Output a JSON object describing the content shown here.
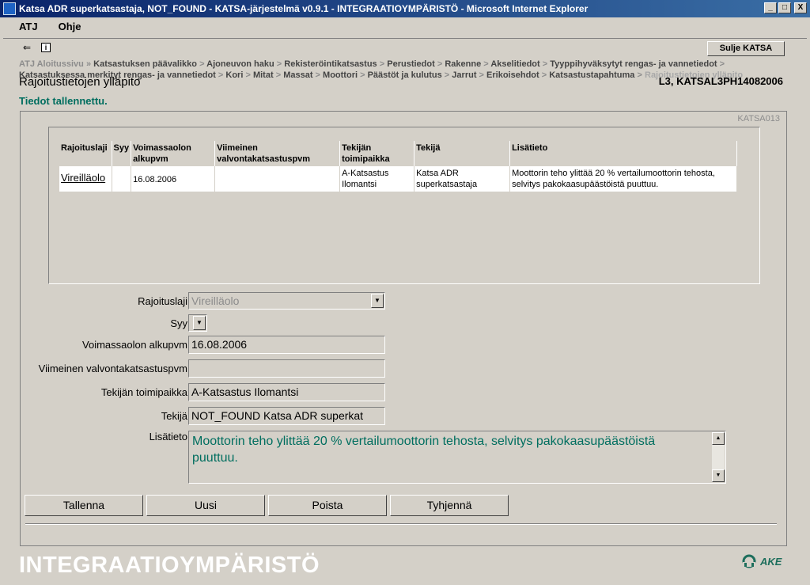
{
  "window": {
    "title": "Katsa ADR superkatsastaja, NOT_FOUND - KATSA-järjestelmä v0.9.1 - INTEGRAATIOYMPÄRISTÖ - Microsoft Internet Explorer",
    "minimize": "_",
    "maximize": "□",
    "close": "X"
  },
  "menu": {
    "items": [
      {
        "label": "ATJ"
      },
      {
        "label": "Ohje"
      }
    ]
  },
  "toolbar": {
    "back_icon": "back-arrow-icon",
    "info_icon": "info-icon",
    "close_label": "Sulje KATSA"
  },
  "breadcrumb": {
    "items": [
      "ATJ Aloitussivu",
      "Katsastuksen päävalikko",
      "Ajoneuvon haku",
      "Rekisteröintikatsastus",
      "Perustiedot",
      "Rakenne",
      "Akselitiedot",
      "Tyyppihyväksytyt rengas- ja vannetiedot",
      "Katsastuksessa merkityt rengas- ja vannetiedot",
      "Kori",
      "Mitat",
      "Massat",
      "Moottori",
      "Päästöt ja kulutus",
      "Jarrut",
      "Erikoisehdot",
      "Katsastustapahtuma",
      "Rajoitustietojen ylläpito"
    ],
    "sep_double": "»",
    "sep": ">"
  },
  "page": {
    "title": "Rajoitustietojen ylläpito",
    "id": "L3, KATSAL3PH14082006",
    "status": "Tiedot tallennettu.",
    "form_code": "KATSA013"
  },
  "table": {
    "headers": [
      "Rajoituslaji",
      "Syy",
      "Voimassaolon alkupvm",
      "Viimeinen valvontakatsastuspvm",
      "Tekijän toimipaikka",
      "Tekijä",
      "Lisätieto"
    ],
    "rows": [
      {
        "rajoituslaji": "Vireilläolo",
        "syy": "",
        "alkupvm": "16.08.2006",
        "valvontapvm": "",
        "toimipaikka": "A-Katsastus Ilomantsi",
        "tekija": "Katsa ADR superkatsastaja",
        "lisatieto": "Moottorin teho ylittää 20 % vertailumoottorin tehosta, selvitys pakokaasupäästöistä puuttuu."
      }
    ]
  },
  "form": {
    "rajoituslaji": {
      "label": "Rajoituslaji",
      "value": "Vireilläolo"
    },
    "syy": {
      "label": "Syy",
      "value": ""
    },
    "alkupvm": {
      "label": "Voimassaolon alkupvm",
      "value": "16.08.2006"
    },
    "valvontapvm": {
      "label": "Viimeinen valvontakatsastuspvm",
      "value": ""
    },
    "toimipaikka": {
      "label": "Tekijän toimipaikka",
      "value": "A-Katsastus Ilomantsi"
    },
    "tekija": {
      "label": "Tekijä",
      "value": "NOT_FOUND Katsa ADR superkat"
    },
    "lisatieto": {
      "label": "Lisätieto",
      "value": "Moottorin teho ylittää 20 % vertailumoottorin tehosta, selvitys pakokaasupäästöistä puuttuu."
    }
  },
  "buttons": {
    "save": "Tallenna",
    "new": "Uusi",
    "delete": "Poista",
    "clear": "Tyhjennä"
  },
  "footer": {
    "environment": "INTEGRAATIOYMPÄRISTÖ",
    "logo_text": "AKE"
  },
  "colors": {
    "titlebar": "#0a246a",
    "panel": "#d4d0c8",
    "status_green": "#006e5f",
    "logo_green": "#1d6e5c"
  }
}
